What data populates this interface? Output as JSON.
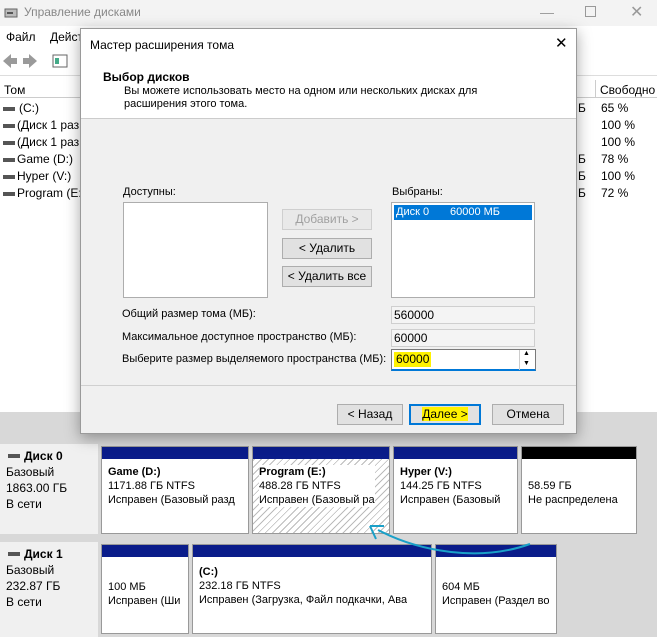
{
  "window": {
    "title": "Управление дисками",
    "menu": [
      "Файл",
      "Дейст"
    ],
    "columns": {
      "volume": "Том",
      "free": "Свободно"
    }
  },
  "volumes": [
    {
      "name": "(C:)",
      "size_tail": "Б",
      "free": "65 %"
    },
    {
      "name": "(Диск 1 раз",
      "size_tail": "",
      "free": "100 %"
    },
    {
      "name": "(Диск 1 раз",
      "size_tail": "",
      "free": "100 %"
    },
    {
      "name": "Game (D:)",
      "size_tail": "Б",
      "free": "78 %"
    },
    {
      "name": "Hyper (V:)",
      "size_tail": "Б",
      "free": "100 %"
    },
    {
      "name": "Program (E:",
      "size_tail": "Б",
      "free": "72 %"
    }
  ],
  "wizard": {
    "title": "Мастер расширения тома",
    "heading": "Выбор дисков",
    "description": "Вы можете использовать место на одном или нескольких дисках для расширения этого тома.",
    "available_label": "Доступны:",
    "selected_label": "Выбраны:",
    "selected_items": [
      {
        "disk": "Диск 0",
        "size": "60000 МБ"
      }
    ],
    "add_button": "Добавить >",
    "remove_button": "< Удалить",
    "remove_all_button": "< Удалить все",
    "total_label": "Общий размер тома (МБ):",
    "total_value": "560000",
    "max_label": "Максимальное доступное пространство (МБ):",
    "max_value": "60000",
    "select_label": "Выберите размер выделяемого пространства (МБ):",
    "select_value": "60000",
    "back_button": "< Назад",
    "next_button": "Далее >",
    "cancel_button": "Отмена"
  },
  "disks": [
    {
      "name": "Диск 0",
      "type": "Базовый",
      "size": "1863.00 ГБ",
      "status": "В сети",
      "partitions": [
        {
          "title": "Game  (D:)",
          "size": "1171.88 ГБ NTFS",
          "state": "Исправен (Базовый разд"
        },
        {
          "title": "Program  (E:)",
          "size": "488.28 ГБ NTFS",
          "state": "Исправен (Базовый ра"
        },
        {
          "title": "Hyper  (V:)",
          "size": "144.25 ГБ NTFS",
          "state": "Исправен (Базовый"
        },
        {
          "title": "",
          "size": "58.59 ГБ",
          "state": "Не распределена"
        }
      ]
    },
    {
      "name": "Диск 1",
      "type": "Базовый",
      "size": "232.87 ГБ",
      "status": "В сети",
      "partitions": [
        {
          "title": "",
          "size": "100 МБ",
          "state": "Исправен (Ши"
        },
        {
          "title": "(C:)",
          "size": "232.18 ГБ NTFS",
          "state": "Исправен (Загрузка, Файл подкачки, Ава"
        },
        {
          "title": "",
          "size": "604 МБ",
          "state": "Исправен (Раздел во"
        }
      ]
    }
  ],
  "colors": {
    "partition_bar": "#0a1c8a",
    "unallocated_bar": "#000000",
    "highlight": "#fff200",
    "accent": "#0078d7",
    "arrow": "#1aa0c8"
  }
}
